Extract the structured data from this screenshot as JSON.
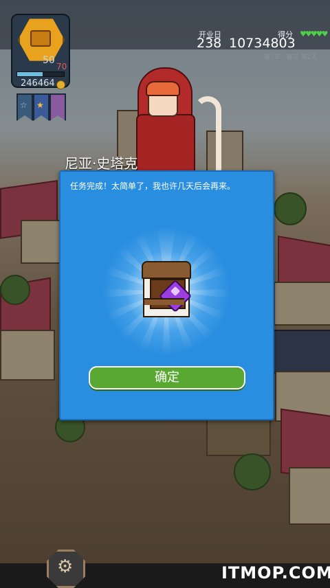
{
  "hud": {
    "level": "50",
    "level_max": "70",
    "coins": "246464",
    "days_label": "开业日",
    "days_value": "238",
    "score_label": "得分",
    "score_value": "10734803",
    "hearts": "♥♥♥♥♥",
    "season": "第7年、春天 第2天",
    "xp_progress": 0.55
  },
  "icons": [
    "hexagon-badge-icon",
    "chest-icon",
    "coin-icon",
    "star-banner-icon",
    "heart-icon",
    "gear-icon",
    "gem-chest-icon"
  ],
  "dialog": {
    "speaker": "尼亚·史塔克",
    "message": "任务完成！太简单了，我也许几天后会再来。",
    "confirm_label": "确定"
  },
  "watermark": "ITMOP.COM",
  "colors": {
    "dialog_bg": "#2a8ee0",
    "button_green": "#58a832",
    "heart_green": "#4fd04a"
  }
}
